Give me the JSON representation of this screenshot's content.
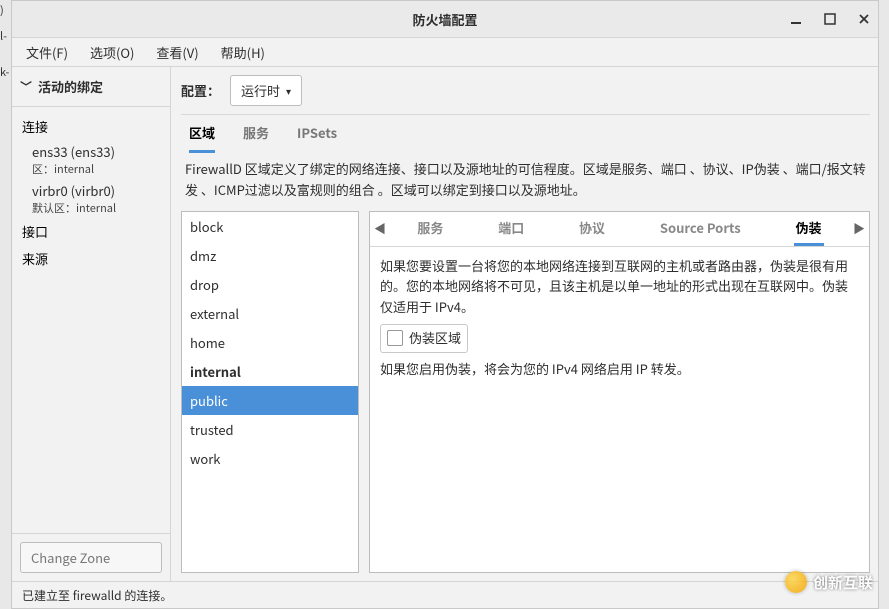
{
  "window": {
    "title": "防火墙配置"
  },
  "left_cutoff": {
    "a": ")",
    "b": "l-",
    "c": "k-"
  },
  "menu": {
    "file": "文件(F)",
    "options": "选项(O)",
    "view": "查看(V)",
    "help": "帮助(H)"
  },
  "sidebar": {
    "header": "活动的绑定",
    "groups": {
      "conn": "连接",
      "iface": "接口",
      "source": "来源"
    },
    "connections": [
      {
        "name": "ens33 (ens33)",
        "sub": "区：internal"
      },
      {
        "name": "virbr0 (virbr0)",
        "sub": "默认区：internal"
      }
    ],
    "change_zone": "Change Zone"
  },
  "config": {
    "label": "配置：",
    "value": "运行时"
  },
  "top_tabs": {
    "zone": "区域",
    "service": "服务",
    "ipsets": "IPSets"
  },
  "zone_desc": "FirewallD 区域定义了绑定的网络连接、接口以及源地址的可信程度。区域是服务、端口 、协议、IP伪装 、端口/报文转发 、ICMP过滤以及富规则的组合 。区域可以绑定到接口以及源地址。",
  "zones": [
    "block",
    "dmz",
    "drop",
    "external",
    "home",
    "internal",
    "public",
    "trusted",
    "work"
  ],
  "zone_selected": "public",
  "zone_bold": "internal",
  "sub_tabs": {
    "service": "服务",
    "port": "端口",
    "protocol": "协议",
    "sourceports": "Source Ports",
    "masq": "伪装"
  },
  "masq": {
    "p1": "如果您要设置一台将您的本地网络连接到互联网的主机或者路由器，伪装是很有用的。您的本地网络将不可见，且该主机是以单一地址的形式出现在互联网中。伪装仅适用于 IPv4。",
    "chk": "伪装区域",
    "p2": "如果您启用伪装，将会为您的 IPv4 网络启用 IP 转发。"
  },
  "status": "已建立至 firewalld 的连接。",
  "brand": "创新互联"
}
